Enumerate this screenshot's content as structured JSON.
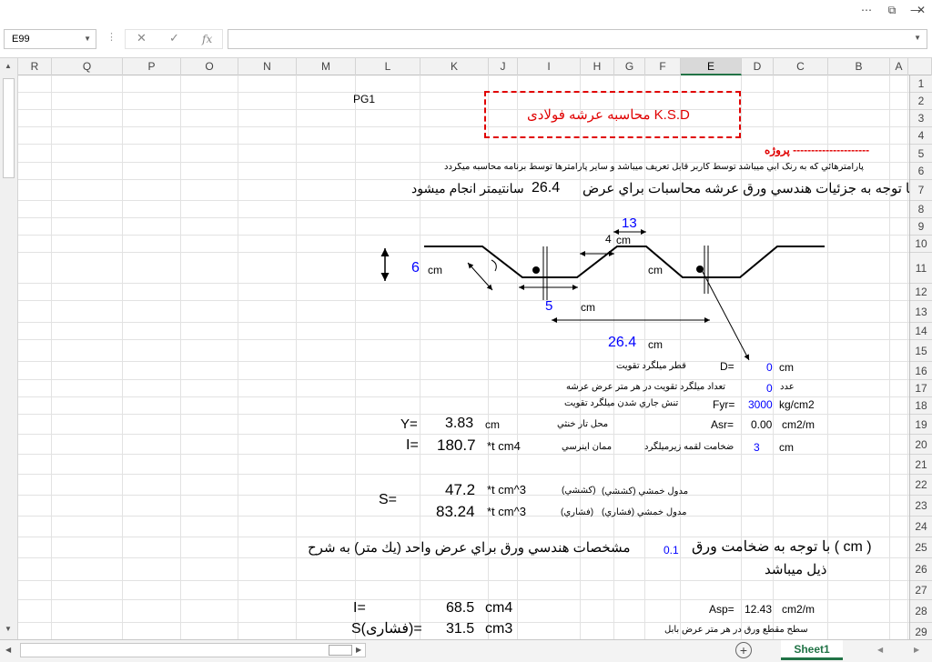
{
  "window": {
    "dropdown_icon": "ribbon-options-icon",
    "restore_icon": "restore-icon",
    "minimize_icon": "minimize-icon",
    "close_icon": "close-icon"
  },
  "formula_bar": {
    "name_box": "E99",
    "cancel": "✕",
    "confirm": "✓",
    "fx": "fx",
    "value": ""
  },
  "columns": [
    "R",
    "Q",
    "P",
    "O",
    "N",
    "M",
    "L",
    "K",
    "J",
    "I",
    "H",
    "G",
    "F",
    "E",
    "D",
    "C",
    "B",
    "A"
  ],
  "selected_column": "E",
  "rows": [
    "1",
    "2",
    "3",
    "4",
    "5",
    "6",
    "7",
    "8",
    "9",
    "10",
    "11",
    "12",
    "13",
    "14",
    "15",
    "16",
    "17",
    "18",
    "19",
    "20",
    "21",
    "22",
    "23",
    "24",
    "25",
    "26",
    "27",
    "28",
    "29"
  ],
  "sheet": {
    "pg1": "PG1",
    "title": "محاسبه عرشه فولادی K.S.D",
    "project": "پروژه ---------------------",
    "note": "پارامترهائي كه به رنگ آبي ميباشد توسط كاربر قابل تعريف ميباشد و ساير پارامترها توسط برنامه محاسبه ميگردد",
    "intro_a": "با توجه به جزئيات هندسي ورق عرشه محاسبات براي عرض",
    "width_val": "26.4",
    "intro_b": "سانتيمتر انجام ميشود",
    "dim_13": "13",
    "dim_4": "4",
    "cm": "cm",
    "dim_6": "6",
    "dim_5": "5",
    "dim_26_4": "26.4",
    "d_label": "قطر ميلگرد تقويت",
    "d_eq": "D=",
    "d_val": "0",
    "n_label_a": "عدد",
    "n_label_b": "تعداد ميلگرد تقويت در هر متر عرض عرشه",
    "n_val": "0",
    "fyr_label": "تنش جاري شدن ميلگرد تقويت",
    "fyr_eq": "Fyr=",
    "fyr_val": "3000",
    "fyr_unit": "kg/cm2",
    "y_eq": "Y=",
    "y_val": "3.83",
    "y_label": "محل تار خنثي",
    "asr_eq": "Asr=",
    "asr_val": "0.00",
    "asr_unit": "cm2/m",
    "i_eq": "I=",
    "i_val": "180.7",
    "i_unit": "*t  cm4",
    "i_label": "ممان اينرسي",
    "thk_label": "ضخامت لقمه زيرميلگرد",
    "thk_val": "3",
    "s_eq": "S=",
    "s1_val": "47.2",
    "s1_unit": "*t  cm^3",
    "s1_paren": "(كششي)",
    "s1_label": "مدول خمشي (كششي)",
    "s2_val": "83.24",
    "s2_unit": "*t  cm^3",
    "s2_paren": "(فشاري)",
    "s2_label": "مدول خمشي (فشاري)",
    "r25_a": "با توجه به ضخامت ورق ( cm )",
    "r25_thk": "0.1",
    "r25_b": "مشخصات هندسي ورق براي عرض واحد (يك متر) به شرح",
    "r26": "ذيل ميباشد",
    "i2_eq": "I=",
    "i2_val": "68.5",
    "i2_unit": "cm4",
    "asp_eq": "Asp=",
    "asp_val": "12.43",
    "asp_unit": "cm2/m",
    "s3_eq": "S(فشاری)=",
    "s3_val": "31.5",
    "s3_unit": "cm3",
    "r29_label": "سطح مقطع ورق در هر متر عرض بابل"
  },
  "status": {
    "sheet_tab": "Sheet1"
  }
}
